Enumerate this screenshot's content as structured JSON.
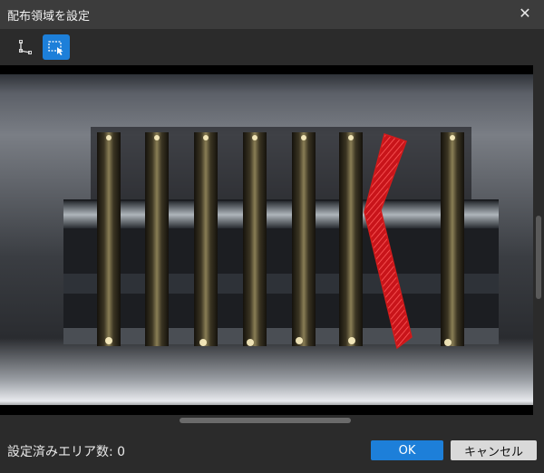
{
  "window": {
    "title": "配布領域を設定",
    "close_glyph": "✕"
  },
  "toolbar": {
    "tools": [
      {
        "icon": "polygon-tool-icon",
        "active": false
      },
      {
        "icon": "region-select-icon",
        "active": true
      }
    ],
    "accent": "#1d7fd9"
  },
  "footer": {
    "status_label": "設定済みエリア数:",
    "status_count": "0",
    "ok_label": "OK",
    "cancel_label": "キャンセル"
  }
}
